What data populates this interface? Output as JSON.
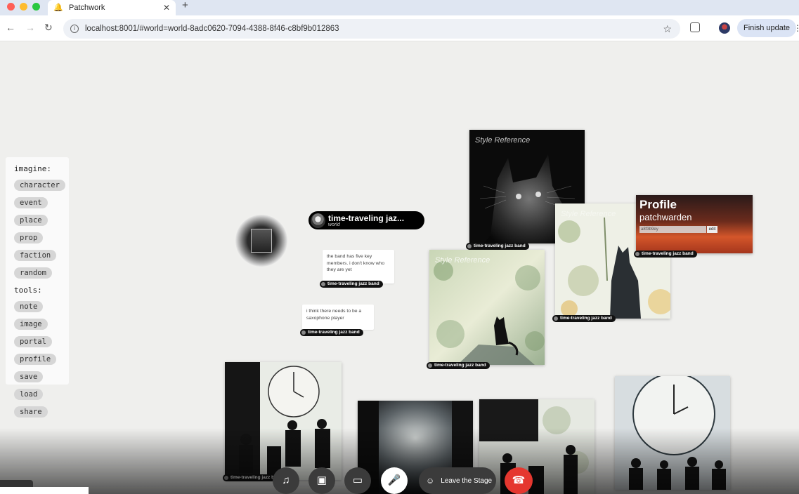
{
  "browser": {
    "tab_title": "Patchwork",
    "url": "localhost:8001/#world=world-8adc0620-7094-4388-8f46-c8bf9b012863",
    "update_label": "Finish update"
  },
  "sidebar": {
    "imagine_heading": "imagine:",
    "imagine_items": [
      "character",
      "event",
      "place",
      "prop",
      "faction",
      "random"
    ],
    "tools_heading": "tools:",
    "tools_items": [
      "note",
      "image",
      "portal",
      "profile",
      "save",
      "load",
      "share"
    ]
  },
  "world_node": {
    "title": "time-traveling jaz...",
    "subtitle": "world"
  },
  "notes": [
    "the band has five key members. i don't know who they are yet",
    "i think there needs to be a saxophone player"
  ],
  "tag_label": "time-traveling jazz band",
  "cards": {
    "style_reference_caption": "Style Reference"
  },
  "profile": {
    "heading": "Profile",
    "username": "patchwarden",
    "input_value": "a8f3b9ey",
    "button_label": "edit"
  },
  "call_controls": {
    "leave_label": "Leave the Stage"
  },
  "colors": {
    "hangup": "#e5372f",
    "tag_bg": "#111111",
    "pill_bg": "#d6d6d6"
  }
}
